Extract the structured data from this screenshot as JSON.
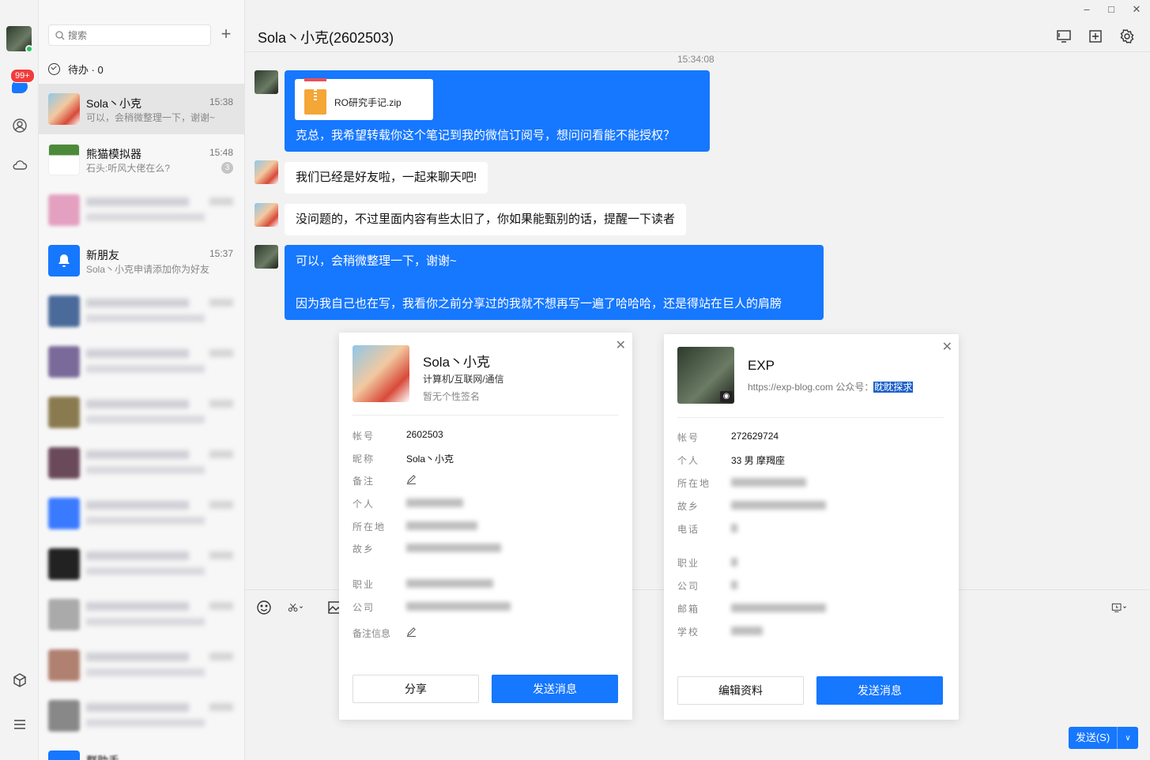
{
  "rail": {
    "badge": "99+"
  },
  "list": {
    "search_placeholder": "搜索",
    "add": "+",
    "todo": "待办 · 0",
    "conversations": [
      {
        "name": "Sola丶小克",
        "time": "15:38",
        "preview": "可以，会稍微整理一下，谢谢~"
      },
      {
        "name": "熊猫模拟器",
        "time": "15:48",
        "preview": "石头:听风大佬在么?",
        "unread": "3"
      },
      {
        "name": "新朋友",
        "time": "15:37",
        "preview": "Sola丶小克申请添加你为好友"
      },
      {
        "name": "群助手"
      }
    ]
  },
  "chat": {
    "title": "Sola丶小克(2602503)",
    "timestamp": "15:34:08",
    "file_name": "RO研究手记.zip",
    "messages": [
      "克总，我希望转载你这个笔记到我的微信订阅号，想问问看能不能授权？",
      "我们已经是好友啦，一起来聊天吧!",
      "没问题的，不过里面内容有些太旧了，你如果能甄别的话，提醒一下读者",
      "可以，会稍微整理一下，谢谢~",
      "因为我自己也在写，我看你之前分享过的我就不想再写一遍了哈哈哈，还是得站在巨人的肩膀"
    ],
    "send_label": "发送(S)"
  },
  "card_left": {
    "name": "Sola丶小克",
    "industry": "计算机/互联网/通信",
    "signature": "暂无个性签名",
    "rows": {
      "account_k": "帐号",
      "account_v": "2602503",
      "nick_k": "昵称",
      "nick_v": "Sola丶小克",
      "remark_k": "备注",
      "personal_k": "个人",
      "location_k": "所在地",
      "hometown_k": "故乡",
      "job_k": "职业",
      "company_k": "公司",
      "remarkinfo_k": "备注信息"
    },
    "share": "分享",
    "send": "发送消息"
  },
  "card_right": {
    "name": "EXP",
    "desc": "https://exp-blog.com 公众号：",
    "desc_hl": "眈眈探求",
    "rows": {
      "account_k": "帐号",
      "account_v": "272629724",
      "personal_k": "个人",
      "personal_v": "33 男 摩羯座",
      "location_k": "所在地",
      "hometown_k": "故乡",
      "phone_k": "电话",
      "job_k": "职业",
      "company_k": "公司",
      "email_k": "邮箱",
      "school_k": "学校"
    },
    "edit": "编辑资料",
    "send": "发送消息"
  },
  "colors": {
    "accent": "#1677ff",
    "badge": "#f23c3c",
    "online": "#22c55e"
  }
}
